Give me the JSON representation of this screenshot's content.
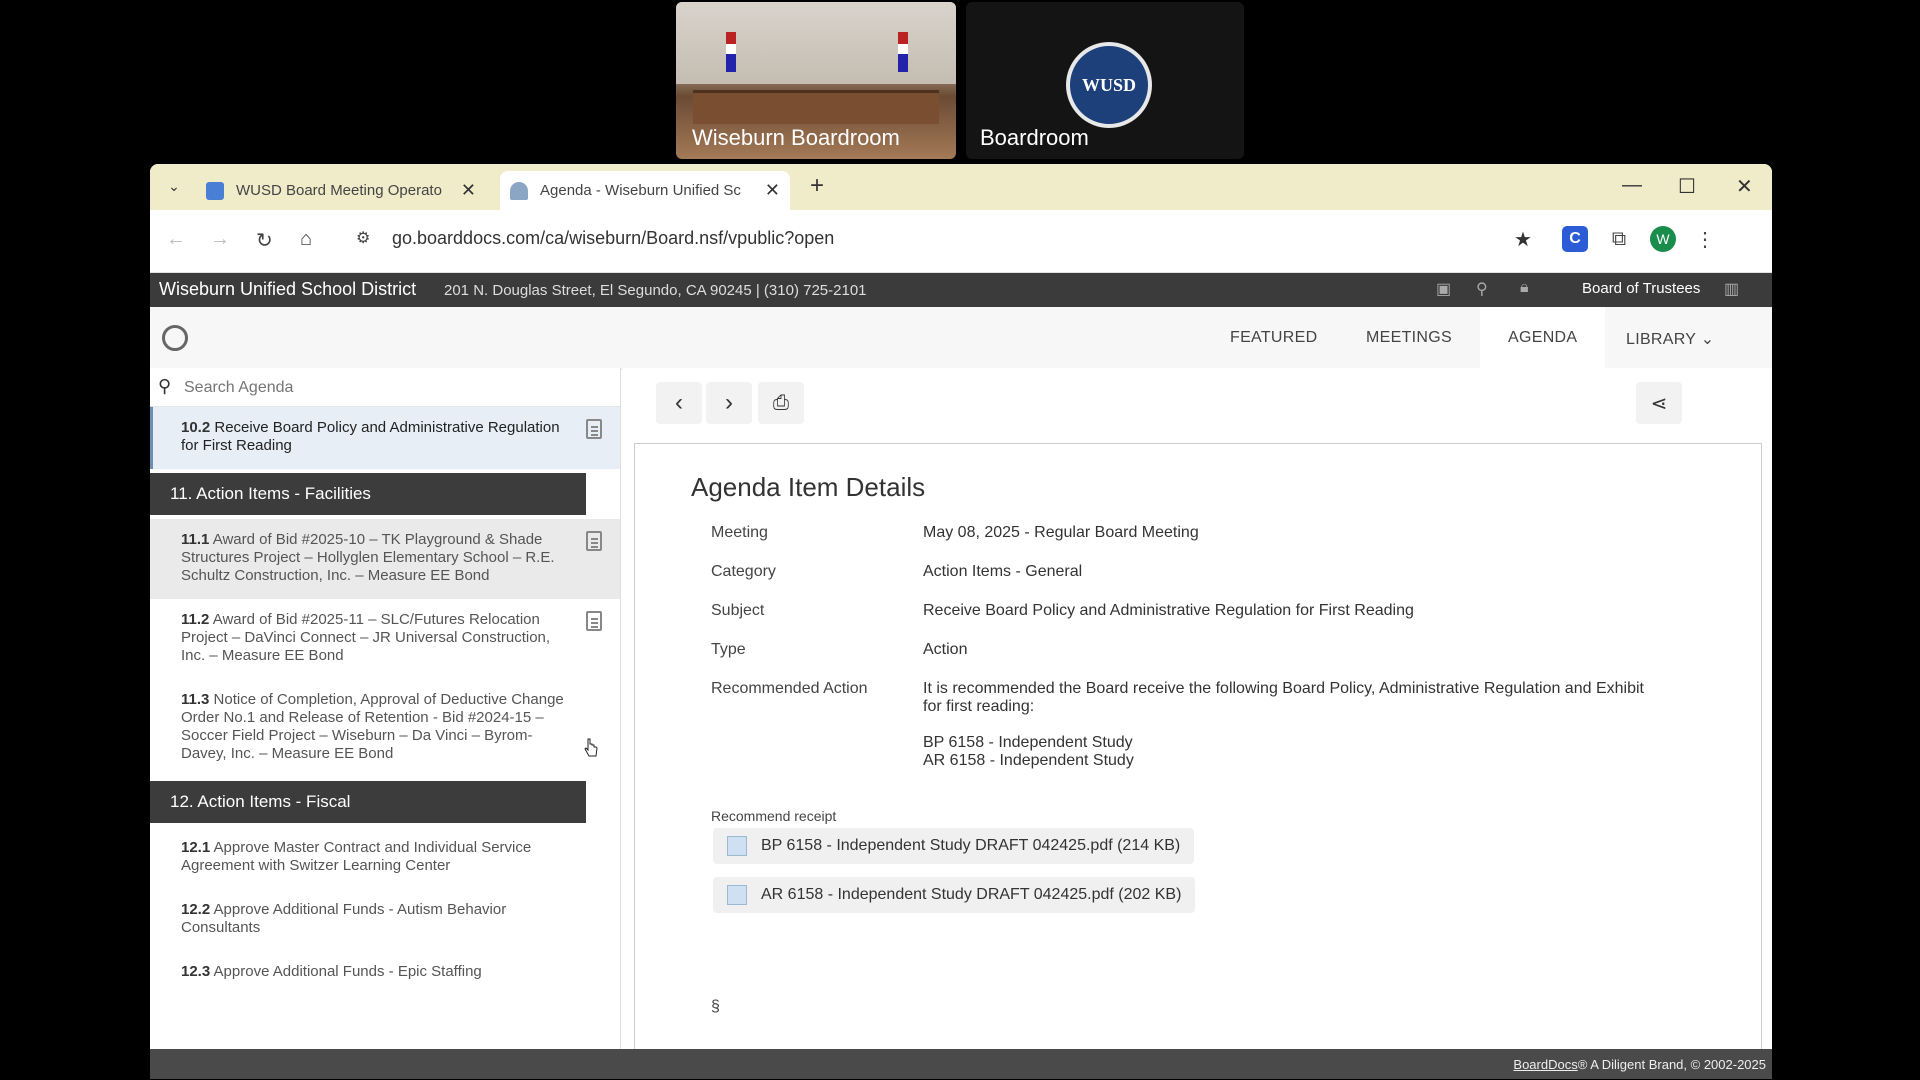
{
  "meeting_tiles": [
    {
      "label": "Wiseburn Boardroom"
    },
    {
      "label": "Boardroom",
      "logo_text": "WUSD"
    }
  ],
  "browser": {
    "tabs": [
      {
        "title": "WUSD Board Meeting Operato",
        "icon": "docs-icon",
        "active": false
      },
      {
        "title": "Agenda - Wiseburn Unified Sc",
        "icon": "boarddocs-icon",
        "active": true
      }
    ],
    "url": "go.boarddocs.com/ca/wiseburn/Board.nsf/vpublic?open",
    "profile_initial": "W"
  },
  "site": {
    "district": "Wiseburn Unified School District",
    "address": "201 N. Douglas Street, El Segundo, CA 90245 | (310) 725-2101",
    "board": "Board of Trustees",
    "nav": [
      "FEATURED",
      "MEETINGS",
      "AGENDA",
      "LIBRARY"
    ]
  },
  "sidebar": {
    "search_placeholder": "Search Agenda",
    "item_10_2": {
      "num": "10.2",
      "text": "Receive Board Policy and Administrative Regulation for First Reading"
    },
    "section_11": "11. Action Items - Facilities",
    "items_11": [
      {
        "num": "11.1",
        "text": "Award of Bid #2025-10 – TK Playground & Shade Structures Project – Hollyglen Elementary School – R.E. Schultz Construction, Inc. – Measure EE Bond"
      },
      {
        "num": "11.2",
        "text": "Award of Bid #2025-11 – SLC/Futures Relocation Project – DaVinci Connect – JR Universal Construction, Inc. – Measure EE Bond"
      },
      {
        "num": "11.3",
        "text": "Notice of Completion, Approval of Deductive Change Order No.1 and Release of Retention - Bid #2024-15 – Soccer Field Project – Wiseburn – Da Vinci – Byrom-Davey, Inc. – Measure EE Bond"
      }
    ],
    "section_12": "12. Action Items - Fiscal",
    "items_12": [
      {
        "num": "12.1",
        "text": "Approve Master Contract and Individual Service Agreement with Switzer Learning Center"
      },
      {
        "num": "12.2",
        "text": "Approve Additional Funds - Autism Behavior Consultants"
      },
      {
        "num": "12.3",
        "text": "Approve Additional Funds - Epic Staffing"
      }
    ]
  },
  "details": {
    "title": "Agenda Item Details",
    "labels": {
      "meeting": "Meeting",
      "category": "Category",
      "subject": "Subject",
      "type": "Type",
      "recommended": "Recommended Action"
    },
    "meeting": "May 08, 2025 - Regular Board Meeting",
    "category": "Action Items - General",
    "subject": "Receive Board Policy and Administrative Regulation for First Reading",
    "type": "Action",
    "recommended_action": "It is recommended the Board receive the following Board Policy, Administrative Regulation and Exhibit for first reading:",
    "bp": "BP 6158 - Independent Study",
    "ar": "AR 6158 - Independent Study",
    "receipt_label": "Recommend receipt",
    "attachments": [
      "BP 6158 - Independent Study DRAFT 042425.pdf (214 KB)",
      "AR 6158 - Independent Study DRAFT 042425.pdf (202 KB)"
    ],
    "section_mark": "§"
  },
  "footer": {
    "brand": "BoardDocs",
    "text": "® A Diligent Brand, © 2002-2025"
  }
}
